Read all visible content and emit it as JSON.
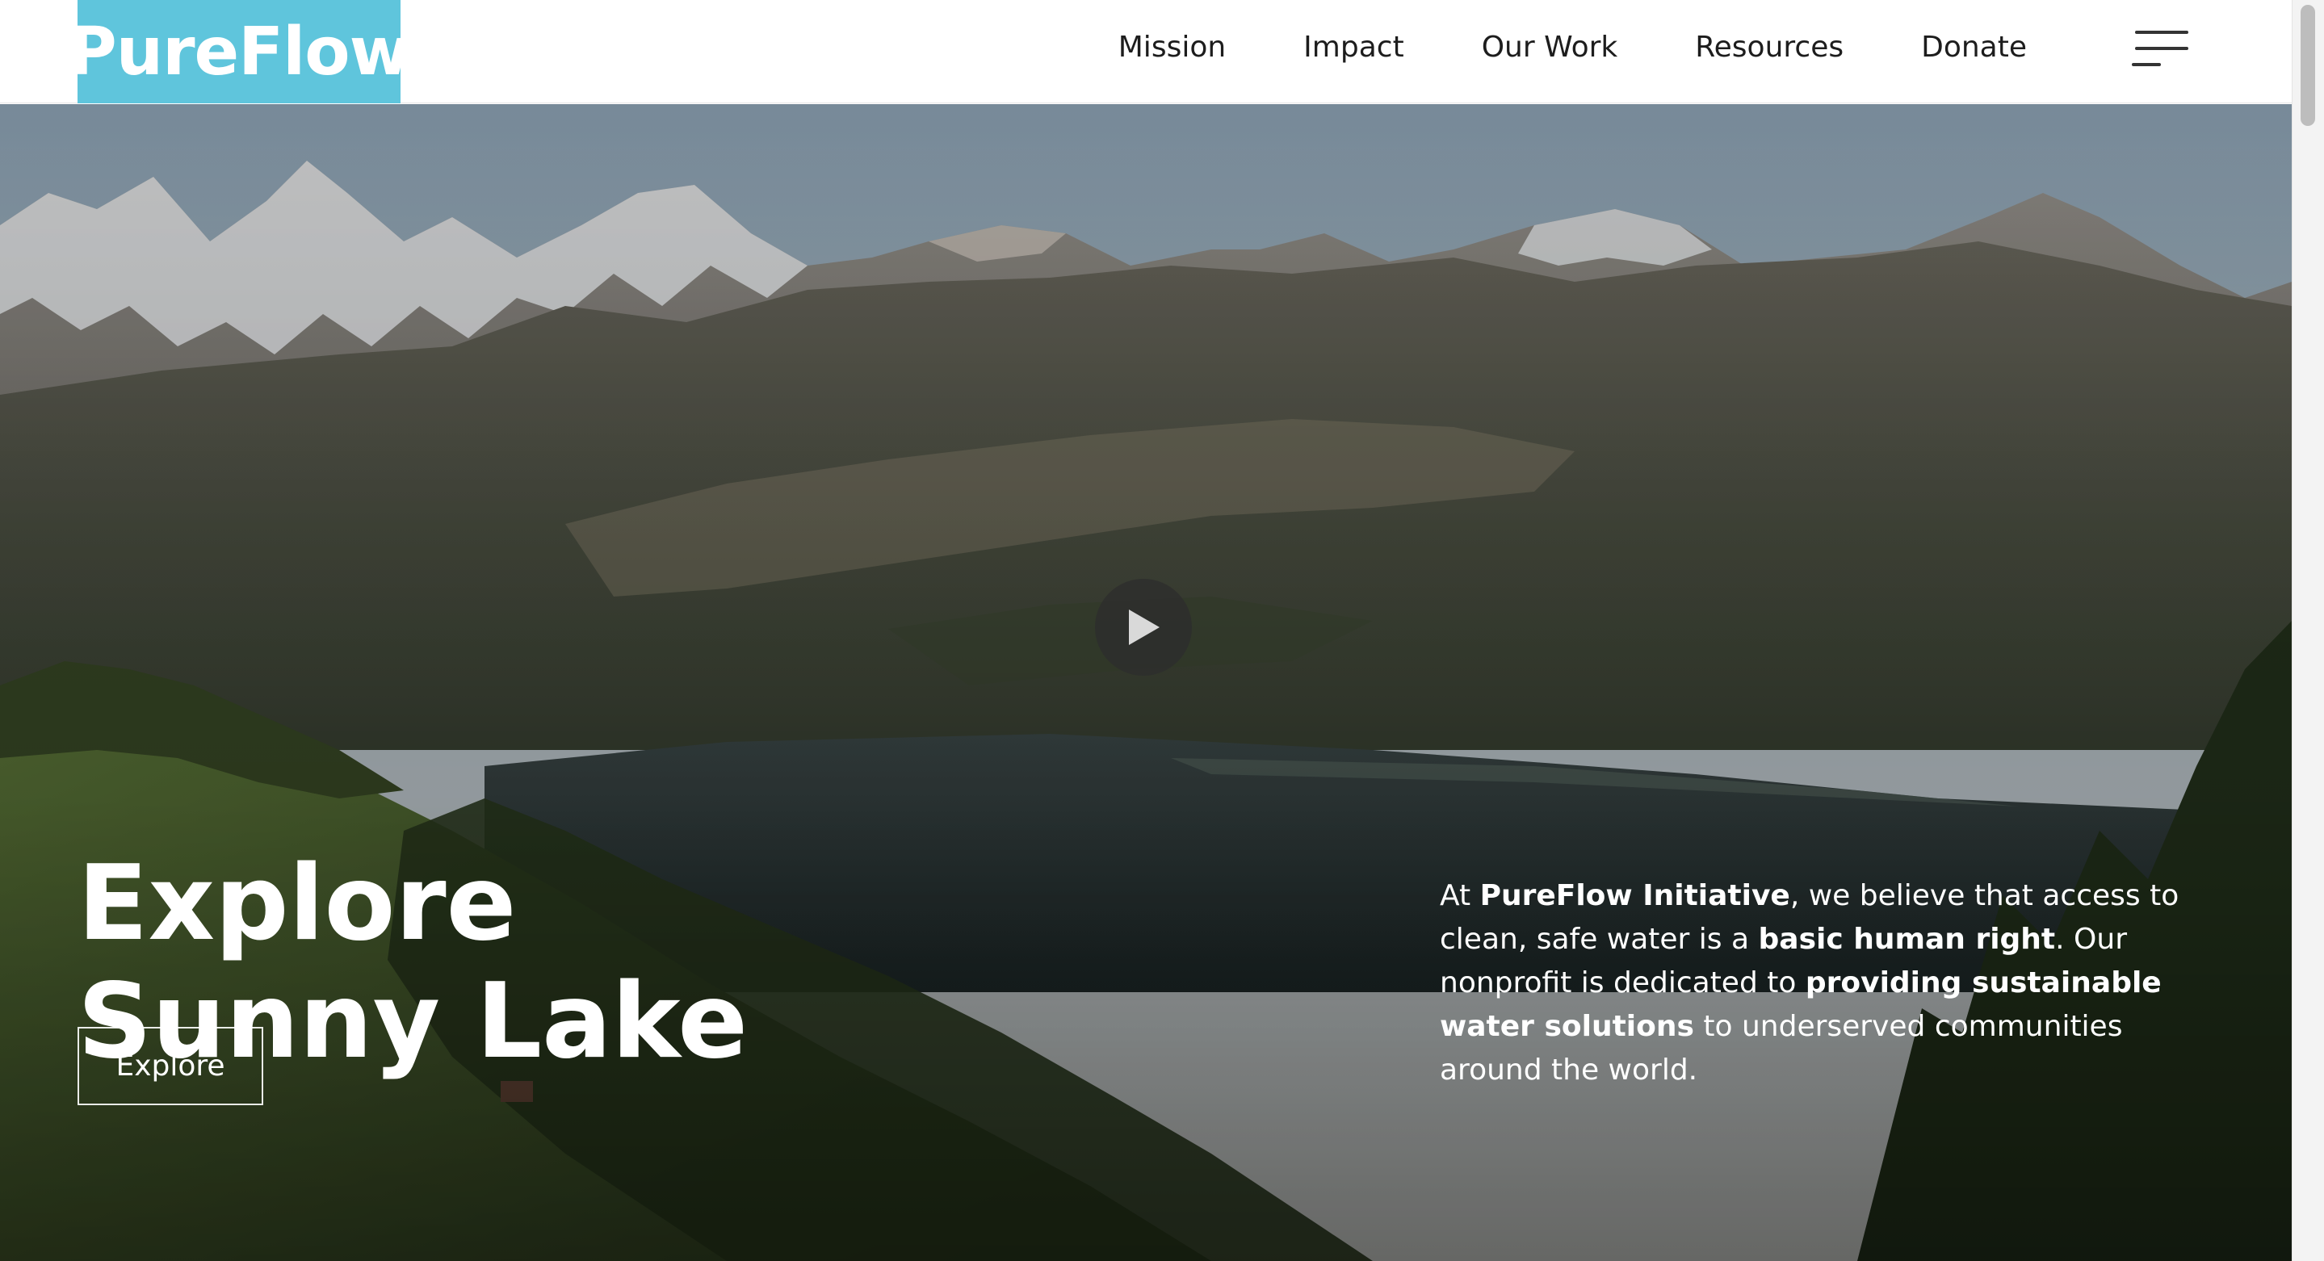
{
  "brand": {
    "name": "PureFlow",
    "color": "#5fc5dc"
  },
  "nav": {
    "items": [
      {
        "label": "Mission"
      },
      {
        "label": "Impact"
      },
      {
        "label": "Our Work"
      },
      {
        "label": "Resources"
      },
      {
        "label": "Donate"
      }
    ],
    "menu_icon": "hamburger-menu-icon"
  },
  "hero": {
    "title_line1": "Explore",
    "title_line2": "Sunny Lake",
    "button_label": "Explore",
    "play_icon": "play-icon",
    "intro": {
      "t1": "At ",
      "b1": "PureFlow Initiative",
      "t2": ", we believe that access to clean, safe water is a ",
      "b2": "basic human right",
      "t3": ". Our nonprofit is dedicated to ",
      "b3": "providing sustainable water solutions",
      "t4": " to underserved communities around the world."
    }
  }
}
